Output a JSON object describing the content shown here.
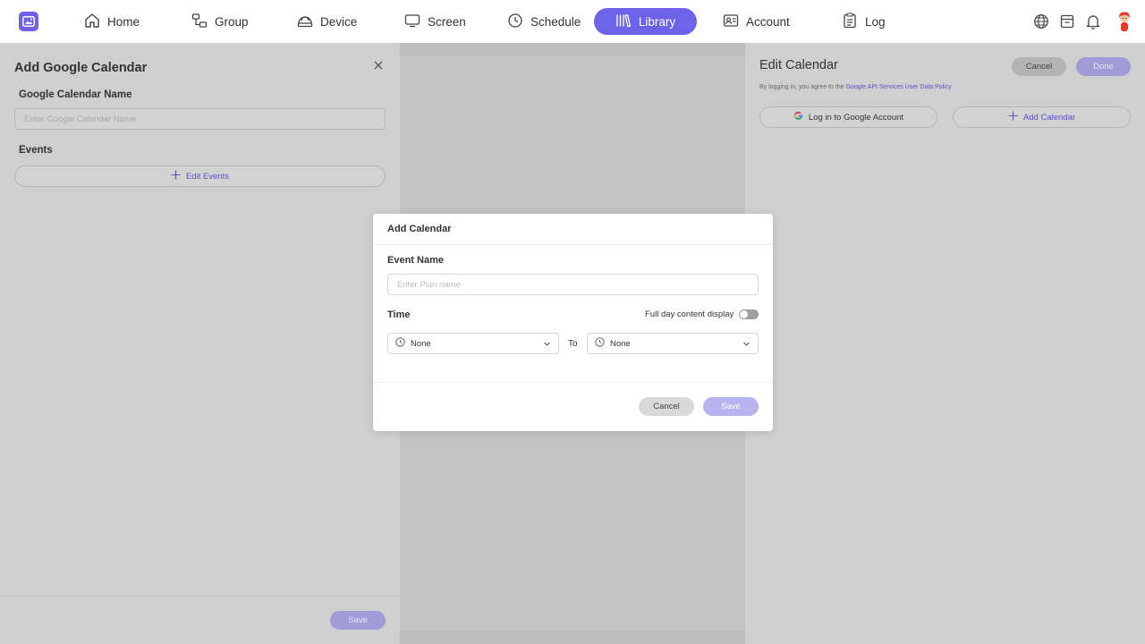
{
  "nav": {
    "items": [
      {
        "label": "Home",
        "icon": "home-icon"
      },
      {
        "label": "Group",
        "icon": "group-icon"
      },
      {
        "label": "Device",
        "icon": "device-icon"
      },
      {
        "label": "Screen",
        "icon": "screen-icon"
      },
      {
        "label": "Schedule",
        "icon": "clock-icon"
      },
      {
        "label": "Library",
        "icon": "library-icon",
        "active": true
      },
      {
        "label": "Account",
        "icon": "account-icon"
      },
      {
        "label": "Log",
        "icon": "log-icon"
      }
    ],
    "right_icons": [
      "globe-icon",
      "storage-icon",
      "bell-icon",
      "avatar"
    ]
  },
  "left_drawer": {
    "title": "Add Google Calendar",
    "name_label": "Google Calendar Name",
    "name_placeholder": "Enter Google Calendar Name",
    "name_value": "",
    "events_label": "Events",
    "edit_events_label": "Edit Events",
    "save_label": "Save"
  },
  "right_drawer": {
    "title": "Edit Calendar",
    "cancel_label": "Cancel",
    "done_label": "Done",
    "note_prefix": "By logging in, you agree to the ",
    "note_link": "Google API Services User Data Policy",
    "login_label": "Log in to Google Account",
    "add_calendar_label": "Add Calendar"
  },
  "modal": {
    "title": "Add Calendar",
    "event_name_label": "Event Name",
    "event_name_placeholder": "Enter Plan name",
    "event_name_value": "",
    "time_label": "Time",
    "full_day_label": "Full day content display",
    "full_day_enabled": false,
    "from_value": "None",
    "to_label": "To",
    "to_value": "None",
    "cancel_label": "Cancel",
    "save_label": "Save"
  },
  "colors": {
    "accent": "#6c63e8",
    "accent_disabled": "#b9b3ef",
    "link": "#5a52c9",
    "google_g": "#4285f4"
  }
}
